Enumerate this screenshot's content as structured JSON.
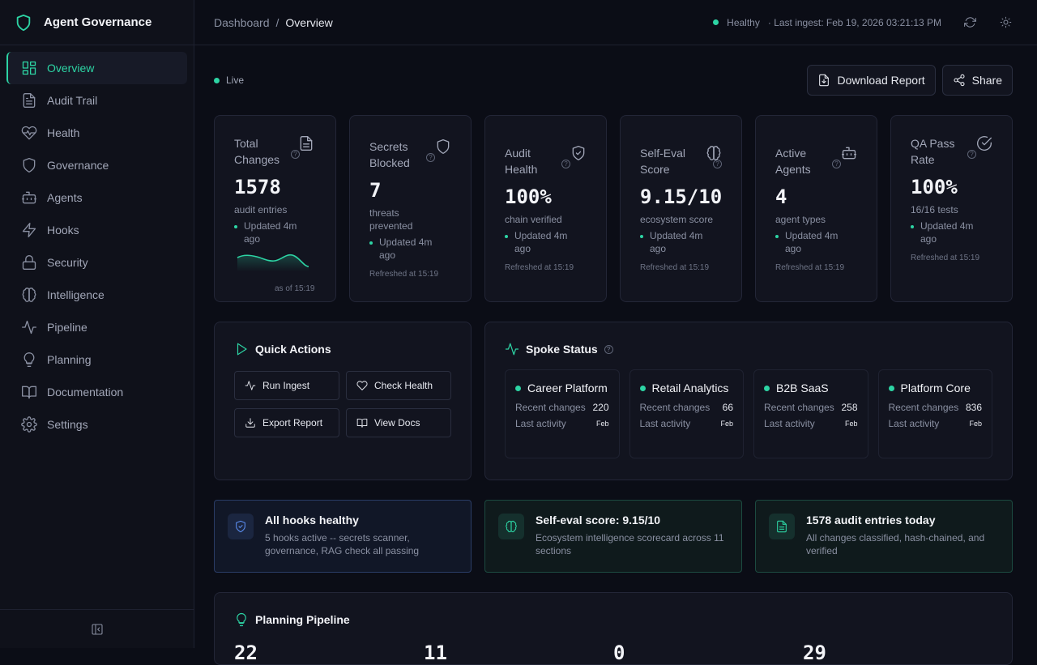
{
  "app": {
    "title": "Agent Governance"
  },
  "sidebar": {
    "items": [
      {
        "label": "Overview",
        "icon": "layout-grid-icon"
      },
      {
        "label": "Audit Trail",
        "icon": "file-text-icon"
      },
      {
        "label": "Health",
        "icon": "heart-pulse-icon"
      },
      {
        "label": "Governance",
        "icon": "shield-icon"
      },
      {
        "label": "Agents",
        "icon": "bot-icon"
      },
      {
        "label": "Hooks",
        "icon": "zap-icon"
      },
      {
        "label": "Security",
        "icon": "lock-icon"
      },
      {
        "label": "Intelligence",
        "icon": "brain-icon"
      },
      {
        "label": "Pipeline",
        "icon": "activity-icon"
      },
      {
        "label": "Planning",
        "icon": "lightbulb-icon"
      },
      {
        "label": "Documentation",
        "icon": "book-open-icon"
      },
      {
        "label": "Settings",
        "icon": "gear-icon"
      }
    ]
  },
  "topbar": {
    "breadcrumb_root": "Dashboard",
    "breadcrumb_sep": "/",
    "breadcrumb_current": "Overview",
    "status": "Healthy",
    "last_ingest": "· Last ingest: Feb 19, 2026 03:21:13 PM"
  },
  "header": {
    "live": "Live",
    "download_label": "Download Report",
    "share_label": "Share"
  },
  "stats": [
    {
      "label": "Total Changes",
      "value": "1578",
      "sub": "audit entries",
      "updated": "Updated 4m ago",
      "footer": "as of 15:19",
      "icon": "file-text-icon"
    },
    {
      "label": "Secrets Blocked",
      "value": "7",
      "sub": "threats prevented",
      "updated": "Updated 4m ago",
      "footer": "Refreshed at 15:19",
      "icon": "shield-icon"
    },
    {
      "label": "Audit Health",
      "value": "100%",
      "sub": "chain verified",
      "updated": "Updated 4m ago",
      "footer": "Refreshed at 15:19",
      "icon": "shield-check-icon"
    },
    {
      "label": "Self-Eval Score",
      "value": "9.15/10",
      "sub": "ecosystem score",
      "updated": "Updated 4m ago",
      "footer": "Refreshed at 15:19",
      "icon": "brain-icon"
    },
    {
      "label": "Active Agents",
      "value": "4",
      "sub": "agent types",
      "updated": "Updated 4m ago",
      "footer": "Refreshed at 15:19",
      "icon": "bot-icon"
    },
    {
      "label": "QA Pass Rate",
      "value": "100%",
      "sub": "16/16 tests",
      "updated": "Updated 4m ago",
      "footer": "Refreshed at 15:19",
      "icon": "check-circle-icon"
    }
  ],
  "quick_actions": {
    "title": "Quick Actions",
    "buttons": [
      {
        "label": "Run Ingest",
        "icon": "activity-icon"
      },
      {
        "label": "Check Health",
        "icon": "heart-icon"
      },
      {
        "label": "Export Report",
        "icon": "download-icon"
      },
      {
        "label": "View Docs",
        "icon": "book-open-icon"
      }
    ]
  },
  "spoke_status": {
    "title": "Spoke Status",
    "recent_label": "Recent changes",
    "activity_label": "Last activity",
    "spokes": [
      {
        "name": "Career Platform",
        "recent": "220",
        "activity": "Feb"
      },
      {
        "name": "Retail Analytics",
        "recent": "66",
        "activity": "Feb"
      },
      {
        "name": "B2B SaaS",
        "recent": "258",
        "activity": "Feb"
      },
      {
        "name": "Platform Core",
        "recent": "836",
        "activity": "Feb"
      }
    ]
  },
  "alerts": [
    {
      "title": "All hooks healthy",
      "text": "5 hooks active -- secrets scanner, governance, RAG check all passing",
      "icon": "shield-check-icon"
    },
    {
      "title": "Self-eval score: 9.15/10",
      "text": "Ecosystem intelligence scorecard across 11 sections",
      "icon": "brain-icon"
    },
    {
      "title": "1578 audit entries today",
      "text": "All changes classified, hash-chained, and verified",
      "icon": "file-text-icon"
    }
  ],
  "planning": {
    "title": "Planning Pipeline",
    "numbers": [
      "22",
      "11",
      "0",
      "29"
    ]
  },
  "colors": {
    "accent": "#2dd4a4",
    "background": "#0b0d16",
    "card": "#12141f",
    "info": "#3b82f6"
  }
}
